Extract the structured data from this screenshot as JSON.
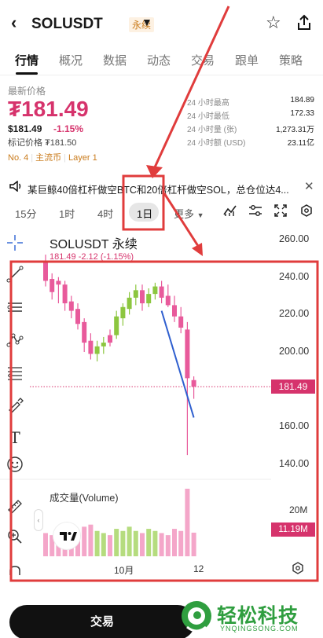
{
  "header": {
    "back_icon": "chevron-left-icon",
    "symbol": "SOLUSDT",
    "perp_badge": "永续",
    "dropdown_icon": "caret-down-icon",
    "favorite_icon": "star-icon",
    "share_icon": "share-icon"
  },
  "tabs": [
    {
      "label": "行情",
      "active": true
    },
    {
      "label": "概况"
    },
    {
      "label": "数据"
    },
    {
      "label": "动态"
    },
    {
      "label": "交易"
    },
    {
      "label": "跟单"
    },
    {
      "label": "策略"
    }
  ],
  "price": {
    "label": "最新价格",
    "value": "₮181.49",
    "sub_value": "$181.49",
    "change": "-1.15%",
    "mark_price": "标记价格 ₮181.50",
    "tags": [
      "No. 4",
      "主流币",
      "Layer 1"
    ]
  },
  "stats": [
    {
      "key": "24 小时最高",
      "value": "184.89"
    },
    {
      "key": "24 小时最低",
      "value": "172.33"
    },
    {
      "key": "24 小时量 (张)",
      "value": "1,273.31万"
    },
    {
      "key": "24 小时额 (USD)",
      "value": "23.11亿"
    }
  ],
  "notice": {
    "icon": "speaker-icon",
    "text": "某巨鲸40倍杠杆做空BTC和20倍杠杆做空SOL，总仓位达4...",
    "close_icon": "close-icon"
  },
  "intervals": [
    {
      "label": "15分"
    },
    {
      "label": "1时"
    },
    {
      "label": "4时"
    },
    {
      "label": "1日",
      "active": true
    },
    {
      "label": "更多"
    }
  ],
  "chart_tools": [
    "indicator-icon",
    "settings-sliders-icon",
    "fullscreen-icon",
    "hexagon-settings-icon"
  ],
  "drawing_tools": [
    "crosshair-icon",
    "trend-line-icon",
    "horizontal-lines-icon",
    "pattern-icon",
    "fib-icon",
    "brush-icon",
    "text-icon",
    "emoji-icon",
    "ruler-icon",
    "zoom-icon",
    "magnet-icon"
  ],
  "chart_data": {
    "type": "candlestick",
    "title": "SOLUSDT 永续",
    "ohlc_text": "181.49  -2.12 (-1.15%)",
    "y_ticks": [
      "260.00",
      "240.00",
      "220.00",
      "200.00",
      "180.00",
      "160.00",
      "140.00"
    ],
    "ylim": [
      130,
      265
    ],
    "current_price_tag": "181.49",
    "current_price": 181.49,
    "x_ticks": [
      "10月",
      "12"
    ],
    "volume_title": "成交量(Volume)",
    "volume_ticks": [
      "20M"
    ],
    "current_volume_tag": "11.19M",
    "candles": [
      {
        "o": 248,
        "h": 252,
        "l": 235,
        "c": 238,
        "v": 11,
        "up": false
      },
      {
        "o": 239,
        "h": 242,
        "l": 228,
        "c": 232,
        "v": 10,
        "up": false
      },
      {
        "o": 238,
        "h": 240,
        "l": 226,
        "c": 236,
        "v": 13,
        "up": false
      },
      {
        "o": 236,
        "h": 238,
        "l": 222,
        "c": 226,
        "v": 11,
        "up": false
      },
      {
        "o": 227,
        "h": 230,
        "l": 218,
        "c": 222,
        "v": 9,
        "up": false
      },
      {
        "o": 223,
        "h": 226,
        "l": 212,
        "c": 215,
        "v": 12,
        "up": false
      },
      {
        "o": 216,
        "h": 218,
        "l": 200,
        "c": 205,
        "v": 14,
        "up": false
      },
      {
        "o": 206,
        "h": 210,
        "l": 196,
        "c": 199,
        "v": 15,
        "up": false
      },
      {
        "o": 199,
        "h": 206,
        "l": 195,
        "c": 203,
        "v": 12,
        "up": true
      },
      {
        "o": 203,
        "h": 208,
        "l": 199,
        "c": 205,
        "v": 11,
        "up": true
      },
      {
        "o": 205,
        "h": 212,
        "l": 203,
        "c": 209,
        "v": 10,
        "up": false
      },
      {
        "o": 209,
        "h": 222,
        "l": 207,
        "c": 219,
        "v": 13,
        "up": true
      },
      {
        "o": 218,
        "h": 226,
        "l": 214,
        "c": 224,
        "v": 12,
        "up": true
      },
      {
        "o": 223,
        "h": 232,
        "l": 220,
        "c": 229,
        "v": 14,
        "up": true
      },
      {
        "o": 229,
        "h": 236,
        "l": 225,
        "c": 233,
        "v": 12,
        "up": true
      },
      {
        "o": 233,
        "h": 236,
        "l": 222,
        "c": 226,
        "v": 11,
        "up": false
      },
      {
        "o": 226,
        "h": 234,
        "l": 224,
        "c": 231,
        "v": 13,
        "up": true
      },
      {
        "o": 231,
        "h": 237,
        "l": 228,
        "c": 235,
        "v": 12,
        "up": true
      },
      {
        "o": 235,
        "h": 238,
        "l": 226,
        "c": 229,
        "v": 11,
        "up": false
      },
      {
        "o": 230,
        "h": 236,
        "l": 224,
        "c": 225,
        "v": 10,
        "up": false
      },
      {
        "o": 225,
        "h": 230,
        "l": 216,
        "c": 219,
        "v": 13,
        "up": false
      },
      {
        "o": 219,
        "h": 224,
        "l": 210,
        "c": 213,
        "v": 12,
        "up": false
      },
      {
        "o": 212,
        "h": 216,
        "l": 145,
        "c": 186,
        "v": 32,
        "up": false
      },
      {
        "o": 185,
        "h": 187,
        "l": 175,
        "c": 181.49,
        "v": 11.19,
        "up": false
      }
    ],
    "colors": {
      "up": "#8cc63f",
      "down": "#e85a9b",
      "vol_up": "#b5dc7e",
      "vol_down": "#f4a6c9",
      "line": "#2f5fcf"
    }
  },
  "bottom": {
    "trade_label": "交易",
    "watermark_title": "轻松科技",
    "watermark_sub": "YNQINGSONG.COM"
  },
  "annotations": {
    "color": "#e03c3c"
  }
}
